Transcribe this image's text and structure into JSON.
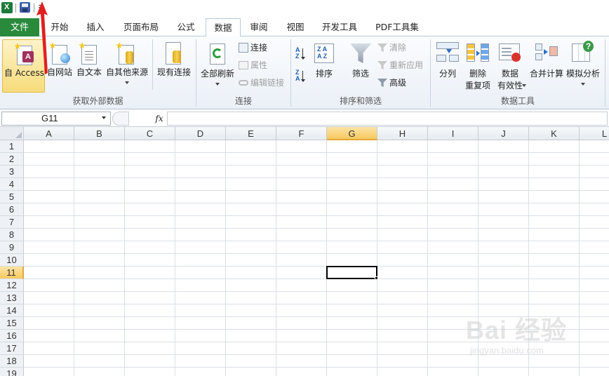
{
  "quick_access": {
    "app_icon": "excel-icon",
    "save_icon": "save-icon",
    "customize_icon": "customize-dropdown-icon"
  },
  "tabs": {
    "file": "文件",
    "items": [
      "开始",
      "插入",
      "页面布局",
      "公式",
      "数据",
      "审阅",
      "视图",
      "开发工具",
      "PDF工具集"
    ],
    "active": "数据"
  },
  "ribbon": {
    "get_external_data": {
      "label": "获取外部数据",
      "from_access": "自 Access",
      "from_web": "自网站",
      "from_text": "自文本",
      "from_other": "自其他来源",
      "existing_connections": "现有连接"
    },
    "connections": {
      "label": "连接",
      "refresh_all": "全部刷新",
      "connections": "连接",
      "properties": "属性",
      "edit_links": "编辑链接"
    },
    "sort_filter": {
      "label": "排序和筛选",
      "sort": "排序",
      "filter": "筛选",
      "clear": "清除",
      "reapply": "重新应用",
      "advanced": "高级"
    },
    "data_tools": {
      "label": "数据工具",
      "text_to_columns": "分列",
      "remove_duplicates_1": "删除",
      "remove_duplicates_2": "重复项",
      "data_validation_1": "数据",
      "data_validation_2": "有效性",
      "consolidate": "合并计算",
      "what_if": "模拟分析"
    }
  },
  "formula_bar": {
    "name_box": "G11",
    "fx_label": "fx",
    "formula": ""
  },
  "sheet": {
    "columns": [
      "A",
      "B",
      "C",
      "D",
      "E",
      "F",
      "G",
      "H",
      "I",
      "J",
      "K",
      "L"
    ],
    "rows": [
      "1",
      "2",
      "3",
      "4",
      "5",
      "6",
      "7",
      "8",
      "9",
      "10",
      "11",
      "12",
      "13",
      "14",
      "15",
      "16",
      "17",
      "18",
      "19"
    ],
    "selected_column": "G",
    "selected_row": "11"
  },
  "watermark": {
    "brand": "Bai 经验",
    "url": "jingyan.baidu.com"
  },
  "colors": {
    "file_tab": "#2a8a3c",
    "selection_header": "#f7c860",
    "annotation_arrow": "#e02020"
  }
}
